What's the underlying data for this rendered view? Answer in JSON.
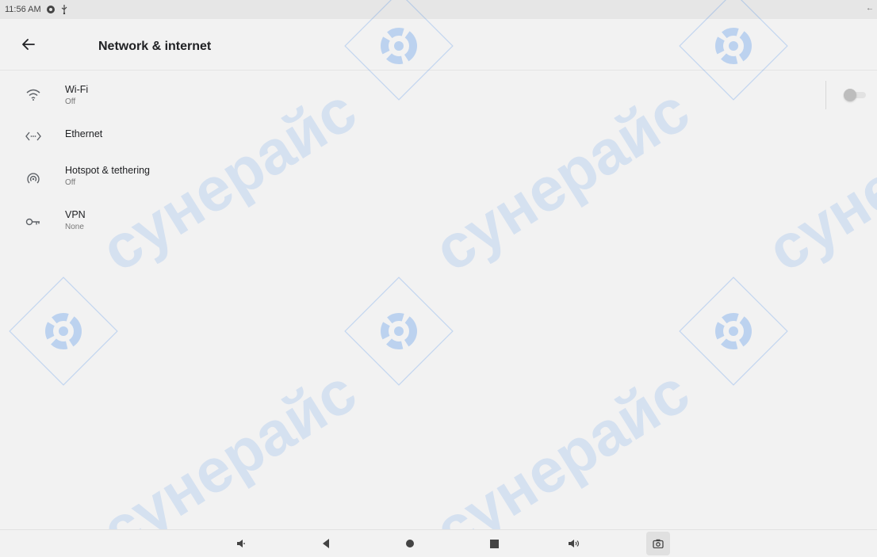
{
  "status_bar": {
    "time": "11:56 AM",
    "icons": [
      "settings-gear-icon",
      "usb-icon"
    ],
    "right_icon": "back-arrow-small-icon"
  },
  "app_bar": {
    "title": "Network & internet",
    "back_icon": "arrow-left-icon"
  },
  "items": [
    {
      "title": "Wi-Fi",
      "subtitle": "Off",
      "icon": "wifi-icon",
      "toggle": "off"
    },
    {
      "title": "Ethernet",
      "icon": "ethernet-icon"
    },
    {
      "title": "Hotspot & tethering",
      "subtitle": "Off",
      "icon": "hotspot-icon"
    },
    {
      "title": "VPN",
      "subtitle": "None",
      "icon": "vpn-key-icon"
    }
  ],
  "nav_bar": {
    "buttons": [
      "volume-down-icon",
      "back-triangle-icon",
      "home-circle-icon",
      "recents-square-icon",
      "volume-up-icon",
      "screenshot-camera-icon"
    ]
  },
  "watermark": {
    "text": "сунерайс"
  },
  "colors": {
    "background": "#f2f2f2",
    "status_bar": "#e6e6e6",
    "watermark": "#1a73e8",
    "text_primary": "#202124",
    "text_secondary": "#777777"
  }
}
